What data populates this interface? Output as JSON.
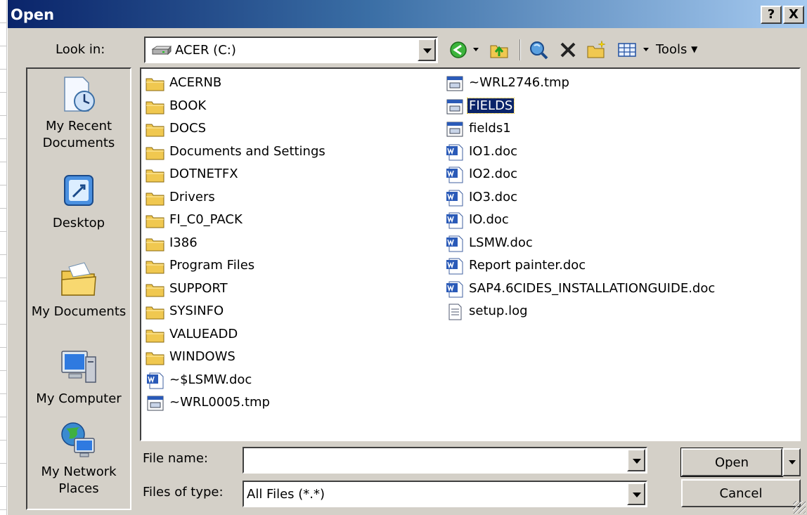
{
  "window": {
    "title": "Open",
    "help_glyph": "?",
    "close_glyph": "X"
  },
  "lookin": {
    "label": "Look in:",
    "value": "ACER (C:)"
  },
  "toolbar": {
    "tools_label": "Tools"
  },
  "places": [
    {
      "label_line1": "My Recent",
      "label_line2": "Documents",
      "icon": "recent-documents-icon"
    },
    {
      "label_line1": "Desktop",
      "label_line2": "",
      "icon": "desktop-icon"
    },
    {
      "label_line1": "My Documents",
      "label_line2": "",
      "icon": "my-documents-icon"
    },
    {
      "label_line1": "My Computer",
      "label_line2": "",
      "icon": "my-computer-icon"
    },
    {
      "label_line1": "My Network",
      "label_line2": "Places",
      "icon": "network-places-icon"
    }
  ],
  "files": {
    "col1": [
      {
        "name": "ACERNB",
        "type": "folder"
      },
      {
        "name": "BOOK",
        "type": "folder"
      },
      {
        "name": "DOCS",
        "type": "folder"
      },
      {
        "name": "Documents and Settings",
        "type": "folder"
      },
      {
        "name": "DOTNETFX",
        "type": "folder"
      },
      {
        "name": "Drivers",
        "type": "folder"
      },
      {
        "name": "FI_C0_PACK",
        "type": "folder"
      },
      {
        "name": "I386",
        "type": "folder"
      },
      {
        "name": "Program Files",
        "type": "folder"
      },
      {
        "name": "SUPPORT",
        "type": "folder"
      },
      {
        "name": "SYSINFO",
        "type": "folder"
      },
      {
        "name": "VALUEADD",
        "type": "folder"
      },
      {
        "name": "WINDOWS",
        "type": "folder"
      },
      {
        "name": "~$LSMW.doc",
        "type": "word"
      },
      {
        "name": "~WRL0005.tmp",
        "type": "window"
      }
    ],
    "col2": [
      {
        "name": "~WRL2746.tmp",
        "type": "window"
      },
      {
        "name": "FIELDS",
        "type": "window",
        "selected": true
      },
      {
        "name": "fields1",
        "type": "window"
      },
      {
        "name": "IO1.doc",
        "type": "word"
      },
      {
        "name": "IO2.doc",
        "type": "word"
      },
      {
        "name": "IO3.doc",
        "type": "word"
      },
      {
        "name": "IO.doc",
        "type": "word"
      },
      {
        "name": "LSMW.doc",
        "type": "word"
      },
      {
        "name": "Report painter.doc",
        "type": "word"
      },
      {
        "name": "SAP4.6CIDES_INSTALLATIONGUIDE.doc",
        "type": "word"
      },
      {
        "name": "setup.log",
        "type": "text"
      }
    ]
  },
  "filename": {
    "label": "File name:",
    "value": ""
  },
  "filetype": {
    "label": "Files of type:",
    "value": "All Files (*.*)"
  },
  "buttons": {
    "open": "Open",
    "cancel": "Cancel"
  },
  "colors": {
    "title_start": "#0a246a",
    "title_end": "#a6caf0",
    "face": "#d4d0c8",
    "selection": "#0a246a"
  }
}
